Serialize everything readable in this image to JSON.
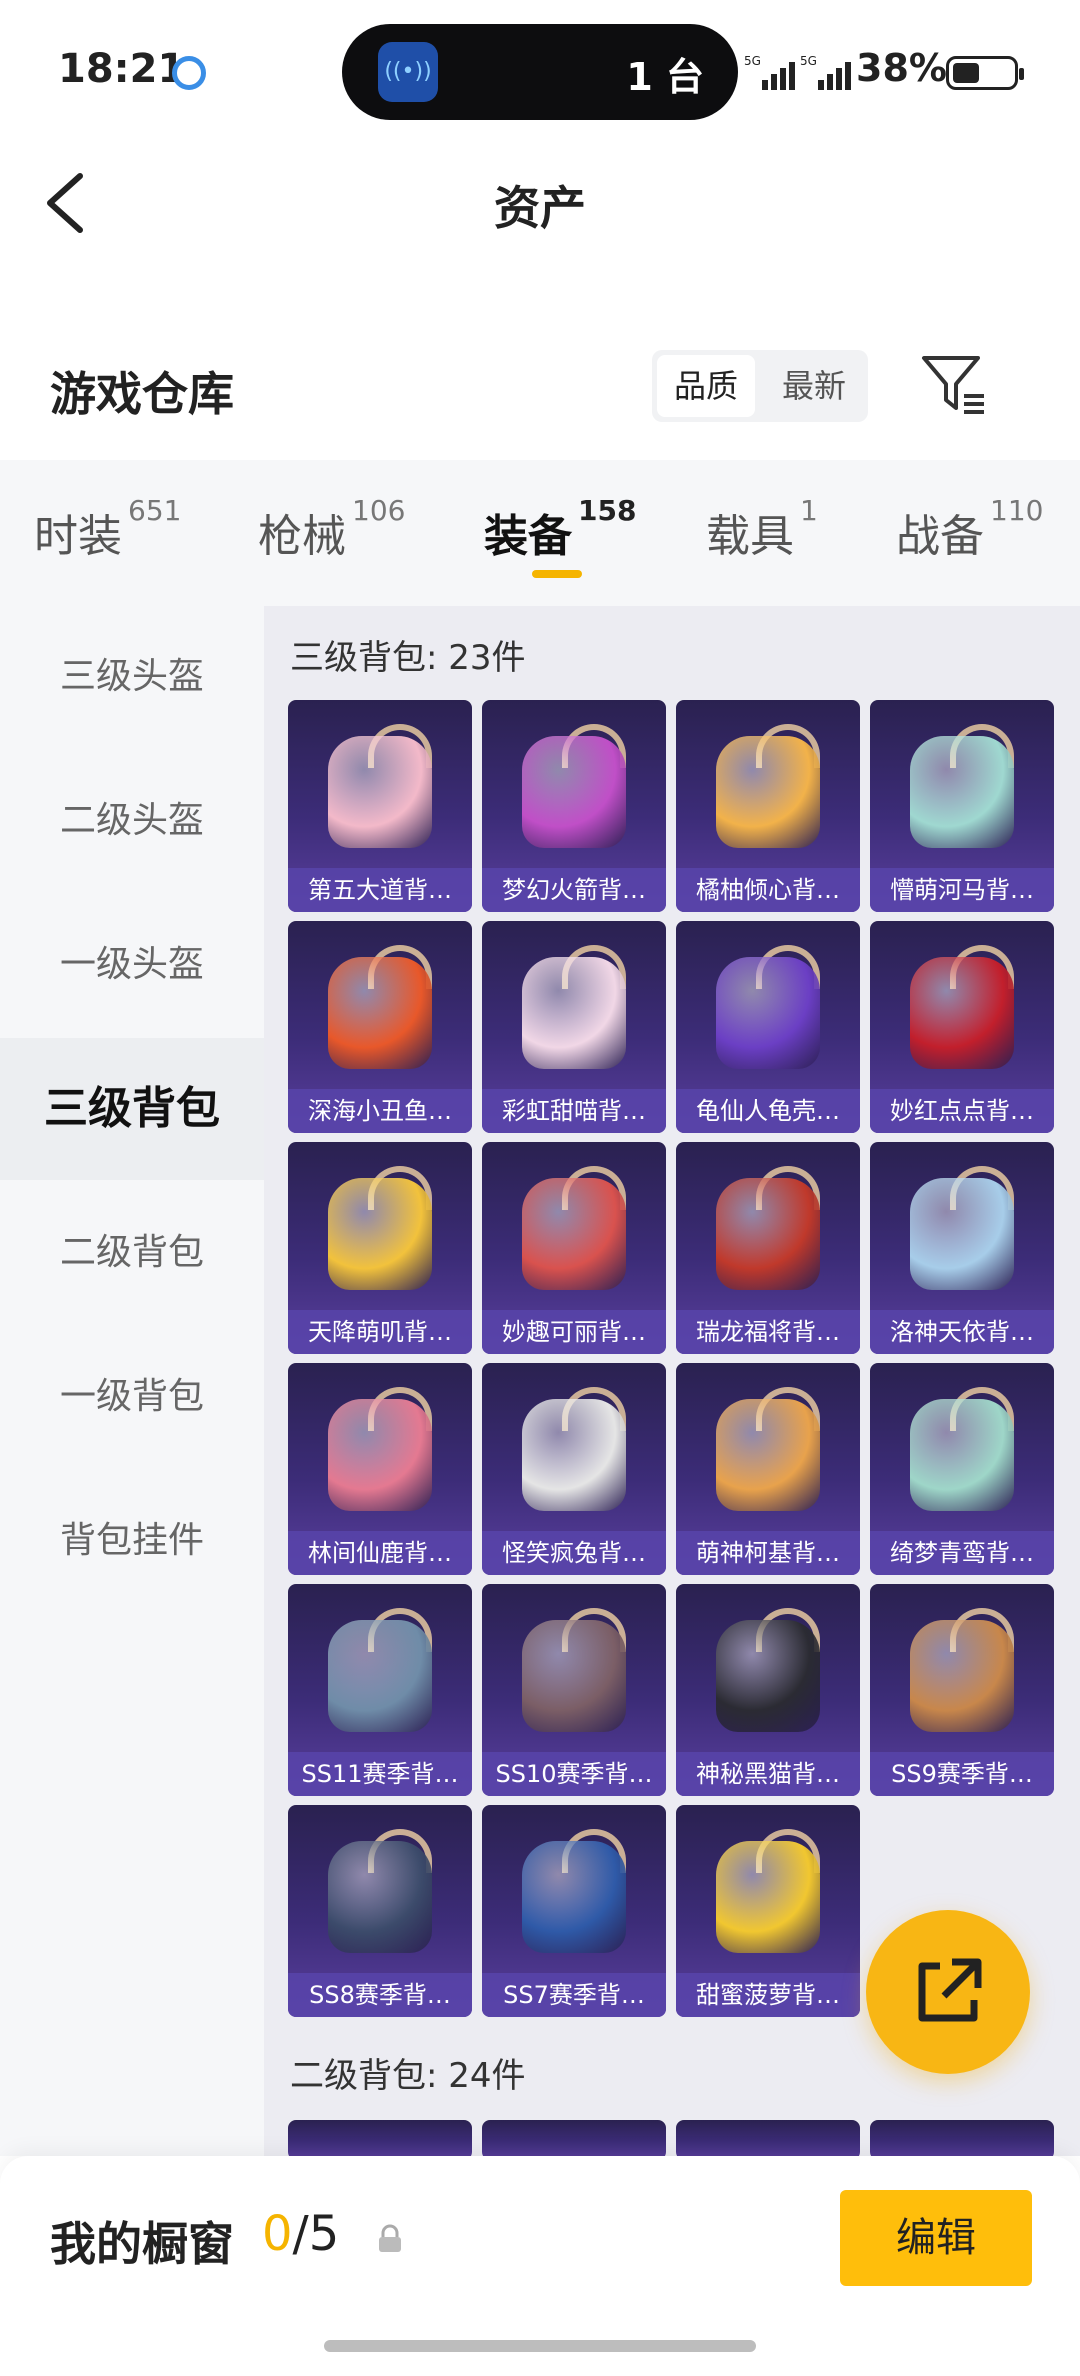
{
  "status": {
    "time": "18:21",
    "island_count": "1 台",
    "sig1": "5G",
    "sig2": "5G",
    "battery": "38%"
  },
  "header": {
    "title": "资产"
  },
  "warehouse": {
    "title": "游戏仓库",
    "sort_quality": "品质",
    "sort_latest": "最新"
  },
  "tabs": [
    {
      "label": "时装",
      "count": "651"
    },
    {
      "label": "枪械",
      "count": "106"
    },
    {
      "label": "装备",
      "count": "158"
    },
    {
      "label": "载具",
      "count": "1"
    },
    {
      "label": "战备",
      "count": "110"
    }
  ],
  "sidebar": {
    "items": [
      "三级头盔",
      "二级头盔",
      "一级头盔",
      "三级背包",
      "二级背包",
      "一级背包",
      "背包挂件"
    ]
  },
  "sections": [
    {
      "title": "三级背包: 23件",
      "items": [
        {
          "name": "第五大道背…",
          "color": "#f3b9c9"
        },
        {
          "name": "梦幻火箭背…",
          "color": "#c04fc7"
        },
        {
          "name": "橘柚倾心背…",
          "color": "#f2b24a"
        },
        {
          "name": "懵萌河马背…",
          "color": "#9fd8d0"
        },
        {
          "name": "深海小丑鱼…",
          "color": "#e8582a"
        },
        {
          "name": "彩虹甜喵背…",
          "color": "#f1d7e6"
        },
        {
          "name": "龟仙人龟壳…",
          "color": "#6b3fc4"
        },
        {
          "name": "妙红点点背…",
          "color": "#c21f2c"
        },
        {
          "name": "天降萌叽背…",
          "color": "#f2c23c"
        },
        {
          "name": "妙趣可丽背…",
          "color": "#d9524e"
        },
        {
          "name": "瑞龙福将背…",
          "color": "#c0392b"
        },
        {
          "name": "洛神天依背…",
          "color": "#a7cde9"
        },
        {
          "name": "林间仙鹿背…",
          "color": "#e47991"
        },
        {
          "name": "怪笑疯兔背…",
          "color": "#e5e5e5"
        },
        {
          "name": "萌神柯基背…",
          "color": "#e8a24c"
        },
        {
          "name": "绮梦青鸾背…",
          "color": "#9ed6c8"
        },
        {
          "name": "SS11赛季背…",
          "color": "#6f8ca8"
        },
        {
          "name": "SS10赛季背…",
          "color": "#7b5e66"
        },
        {
          "name": "神秘黑猫背…",
          "color": "#2b2b33"
        },
        {
          "name": "SS9赛季背…",
          "color": "#c8874b"
        },
        {
          "name": "SS8赛季背…",
          "color": "#3c4b6b"
        },
        {
          "name": "SS7赛季背…",
          "color": "#2f5aa8"
        },
        {
          "name": "甜蜜菠萝背…",
          "color": "#f1c730"
        }
      ]
    },
    {
      "title": "二级背包: 24件"
    }
  ],
  "bottom": {
    "label": "我的橱窗",
    "count_current": "0",
    "count_total": "/5",
    "edit_label": "编辑"
  },
  "colors": {
    "accent": "#f5b400",
    "card_purple": "#3c2c78"
  }
}
